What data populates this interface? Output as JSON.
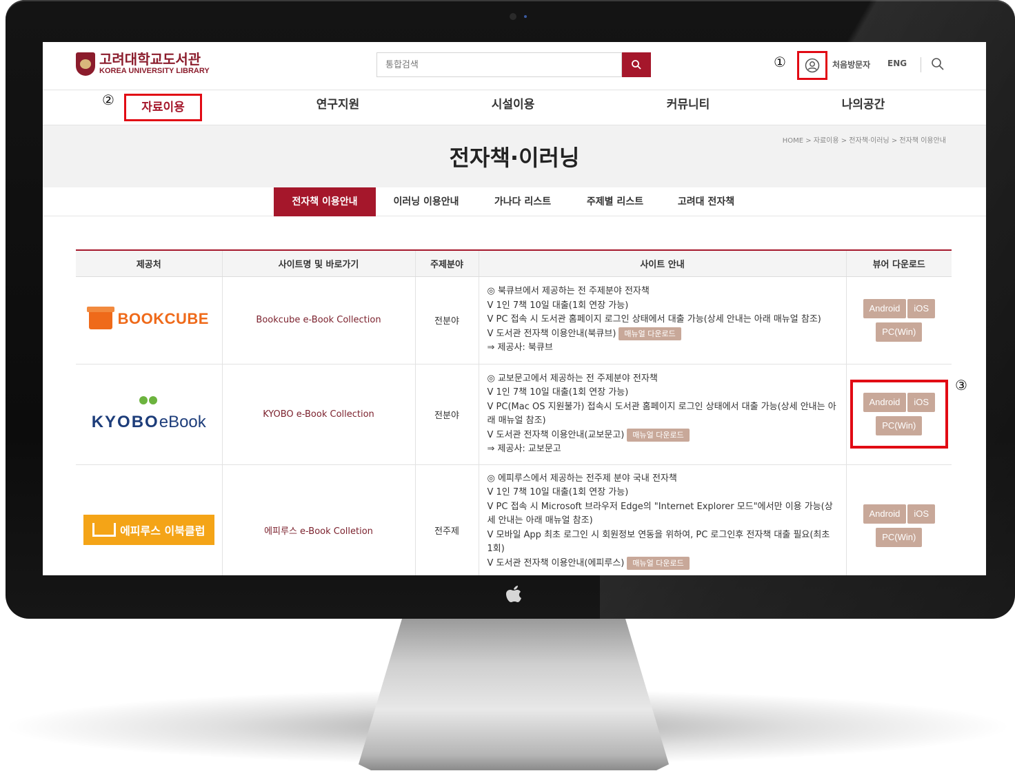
{
  "header": {
    "logo_kr": "고려대학교도서관",
    "logo_en": "KOREA UNIVERSITY LIBRARY",
    "search_placeholder": "통합검색",
    "first_visitor": "처음방문자",
    "language": "ENG"
  },
  "annotations": {
    "marker1": "①",
    "marker2": "②",
    "marker3": "③"
  },
  "gnb": {
    "items": [
      "자료이용",
      "연구지원",
      "시설이용",
      "커뮤니티",
      "나의공간"
    ]
  },
  "hero": {
    "breadcrumb": "HOME > 자료이용 > 전자책·이러닝 > 전자책 이용안내",
    "title": "전자책·이러닝"
  },
  "subtabs": [
    "전자책 이용안내",
    "이러닝 이용안내",
    "가나다 리스트",
    "주제별 리스트",
    "고려대 전자책"
  ],
  "table": {
    "headers": [
      "제공처",
      "사이트명 및 바로가기",
      "주제분야",
      "사이트 안내",
      "뷰어 다운로드"
    ],
    "rows": [
      {
        "provider_logo": "BOOKCUBE",
        "site": "Bookcube e-Book Collection",
        "subject": "전분야",
        "lines": [
          "◎ 북큐브에서 제공하는 전 주제분야 전자책",
          "V 1인 7책 10일 대출(1회 연장 가능)",
          "V PC 접속 시 도서관 홈페이지 로그인 상태에서 대출 가능(상세 안내는 아래 매뉴얼 참조)",
          "V 도서관 전자책 이용안내(북큐브)",
          "⇒ 제공사: 북큐브"
        ],
        "manual": "매뉴얼 다운로드",
        "viewers": [
          "Android",
          "iOS",
          "PC(Win)"
        ]
      },
      {
        "provider_logo_bold": "KYOBO",
        "provider_logo_light": "eBook",
        "site": "KYOBO e-Book Collection",
        "subject": "전분야",
        "lines": [
          "◎ 교보문고에서 제공하는 전 주제분야 전자책",
          "V 1인 7책 10일 대출(1회 연장 가능)",
          "V PC(Mac OS 지원불가) 접속시 도서관 홈페이지 로그인 상태에서 대출 가능(상세 안내는 아래 매뉴얼 참조)",
          "V 도서관 전자책 이용안내(교보문고)",
          "⇒ 제공사: 교보문고"
        ],
        "manual": "매뉴얼 다운로드",
        "viewers": [
          "Android",
          "iOS",
          "PC(Win)"
        ]
      },
      {
        "provider_logo": "에피루스 이북클럽",
        "site": "에피루스 e-Book Colletion",
        "subject": "전주제",
        "lines": [
          "◎ 에피루스에서 제공하는 전주제 분야 국내 전자책",
          "V 1인 7책 10일 대출(1회 연장 가능)",
          "V PC 접속 시 Microsoft 브라우저 Edge의 \"Internet Explorer 모드\"에서만 이용 가능(상세 안내는 아래 매뉴얼 참조)",
          "V 모바일 App 최초 로그인 시 회원정보 연동을 위하여, PC 로그인후 전자책 대출 필요(최초 1회)",
          "V 도서관 전자책 이용안내(에피루스)"
        ],
        "manual": "매뉴얼 다운로드",
        "viewers": [
          "Android",
          "iOS",
          "PC(Win)"
        ]
      }
    ]
  },
  "colors": {
    "brand": "#a5172b",
    "highlight": "#e10a14",
    "viewer_button": "#c8a899"
  }
}
